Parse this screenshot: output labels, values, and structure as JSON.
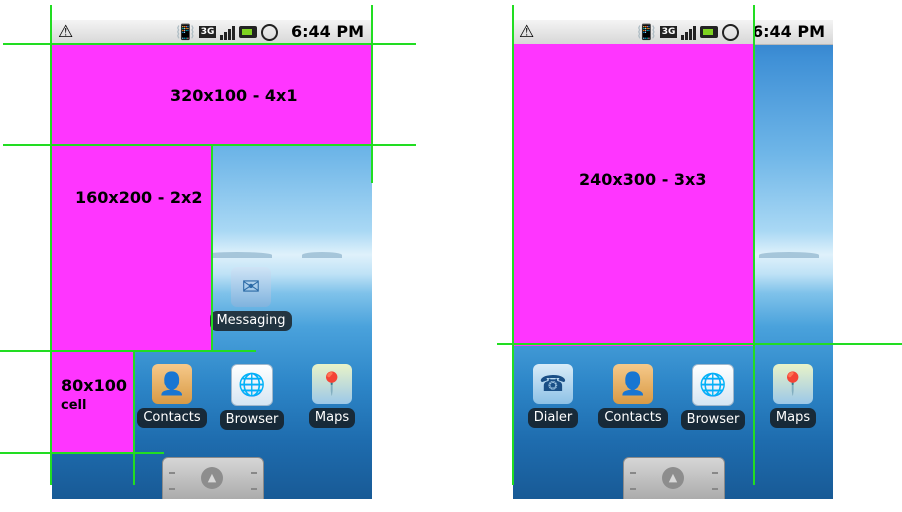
{
  "statusbar": {
    "time": "6:44 PM",
    "warning_icon": "warning-triangle-icon"
  },
  "left": {
    "widgets": [
      {
        "label": "320x100 - 4x1"
      },
      {
        "label": "160x200 - 2x2"
      },
      {
        "label": "80x100",
        "sublabel": "cell"
      }
    ],
    "apps": [
      {
        "label": "Messaging",
        "icon": "messaging-icon"
      },
      {
        "label": "Contacts",
        "icon": "contacts-icon"
      },
      {
        "label": "Browser",
        "icon": "browser-icon"
      },
      {
        "label": "Maps",
        "icon": "maps-icon"
      }
    ]
  },
  "right": {
    "widgets": [
      {
        "label": "240x300 - 3x3"
      }
    ],
    "apps": [
      {
        "label": "Dialer",
        "icon": "dialer-icon"
      },
      {
        "label": "Contacts",
        "icon": "contacts-icon"
      },
      {
        "label": "Browser",
        "icon": "browser-icon"
      },
      {
        "label": "Maps",
        "icon": "maps-icon"
      }
    ]
  },
  "colors": {
    "widget": "#ff35ff",
    "grid_line": "#22dd22",
    "label_bg": "#141414"
  }
}
